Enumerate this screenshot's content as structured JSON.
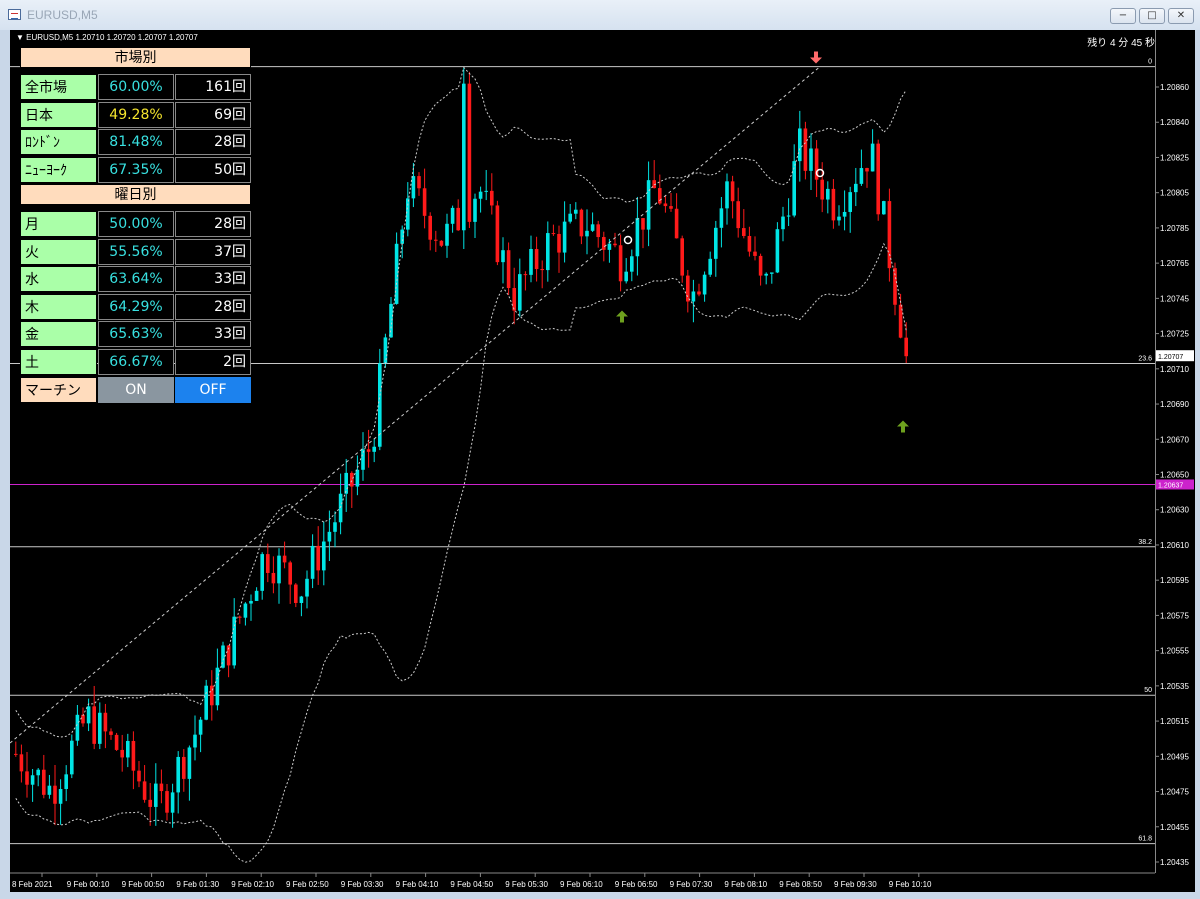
{
  "window": {
    "title": "EURUSD,M5",
    "min_label": "−",
    "max_label": "□",
    "close_label": "✕"
  },
  "chart": {
    "info": "▼ EURUSD,M5  1.20710 1.20720 1.20707 1.20707",
    "timer": "残り 4 分 45 秒",
    "current_price": "1.20707",
    "magenta_price": "1.20637",
    "colors": {
      "bull": "#00e5e5",
      "bear": "#ff1a1a",
      "fib": "#c8c8c8",
      "magenta": "#cc22cc",
      "signal_up": "#6ea11e",
      "signal_down": "#ff6b6b"
    }
  },
  "chart_data": {
    "type": "candlestick",
    "symbol": "EURUSD",
    "timeframe": "M5",
    "ylim": [
      1.20425,
      1.20885
    ],
    "y_ticks": [
      "1.20860",
      "1.20840",
      "1.20825",
      "1.20805",
      "1.20785",
      "1.20765",
      "1.20745",
      "1.20725",
      "1.20710",
      "1.20690",
      "1.20670",
      "1.20650",
      "1.20630",
      "1.20610",
      "1.20595",
      "1.20575",
      "1.20555",
      "1.20535",
      "1.20515",
      "1.20495",
      "1.20475",
      "1.20455",
      "1.20435"
    ],
    "x_ticks": [
      "8 Feb 2021",
      "9 Feb 00:10",
      "9 Feb 00:50",
      "9 Feb 01:30",
      "9 Feb 02:10",
      "9 Feb 02:50",
      "9 Feb 03:30",
      "9 Feb 04:10",
      "9 Feb 04:50",
      "9 Feb 05:30",
      "9 Feb 06:10",
      "9 Feb 06:50",
      "9 Feb 07:30",
      "9 Feb 08:10",
      "9 Feb 08:50",
      "9 Feb 09:30",
      "9 Feb 10:10"
    ],
    "fib_levels": [
      {
        "label": "0",
        "price": 1.20865
      },
      {
        "label": "23.6",
        "price": 1.20703
      },
      {
        "label": "38.2",
        "price": 1.20603
      },
      {
        "label": "50",
        "price": 1.20522
      },
      {
        "label": "61.8",
        "price": 1.20441
      }
    ],
    "path_key": [
      1.2049,
      1.2047,
      1.2051,
      1.2049,
      1.2046,
      1.205,
      1.2055,
      1.206,
      1.2058,
      1.2062,
      1.2066,
      1.208,
      1.2077,
      1.208,
      1.2074,
      1.2077,
      1.2078,
      1.2076,
      1.208,
      1.2074,
      1.208,
      1.2074,
      1.2082,
      1.2079,
      1.2082,
      1.2071
    ],
    "signals": [
      {
        "type": "up",
        "price": 1.20733
      },
      {
        "type": "up",
        "price": 1.20673
      },
      {
        "type": "down",
        "price": 1.2087
      }
    ]
  },
  "panel": {
    "market_header": "市場別",
    "market": [
      {
        "label": "全市場",
        "pct": "60.00%",
        "count": "161回",
        "style": ""
      },
      {
        "label": "日本",
        "pct": "49.28%",
        "count": "69回",
        "style": "yellow"
      },
      {
        "label": "ﾛﾝﾄﾞﾝ",
        "pct": "81.48%",
        "count": "28回",
        "style": ""
      },
      {
        "label": "ﾆｭｰﾖｰｸ",
        "pct": "67.35%",
        "count": "50回",
        "style": ""
      }
    ],
    "weekday_header": "曜日別",
    "weekday": [
      {
        "label": "月",
        "pct": "50.00%",
        "count": "28回"
      },
      {
        "label": "火",
        "pct": "55.56%",
        "count": "37回"
      },
      {
        "label": "水",
        "pct": "63.64%",
        "count": "33回"
      },
      {
        "label": "木",
        "pct": "64.29%",
        "count": "28回"
      },
      {
        "label": "金",
        "pct": "65.63%",
        "count": "33回"
      },
      {
        "label": "土",
        "pct": "66.67%",
        "count": "2回"
      }
    ],
    "martin": {
      "label": "マーチン",
      "on": "ON",
      "off": "OFF"
    }
  }
}
